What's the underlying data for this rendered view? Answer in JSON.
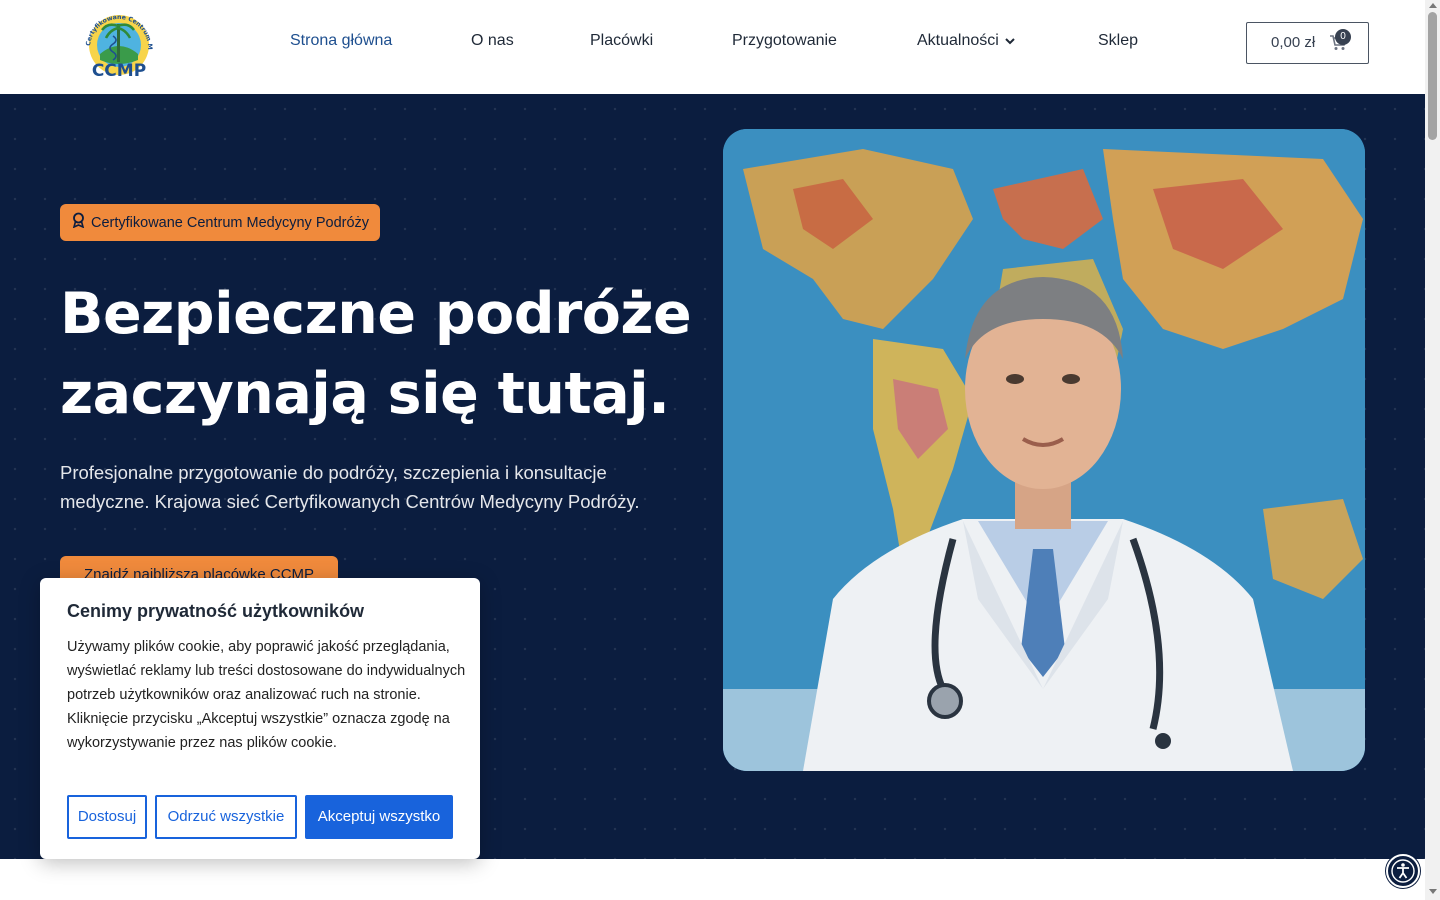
{
  "header": {
    "logo_text": "CCMP",
    "logo_arc_text": "Certyfikowane Centrum Medycyny Podróży",
    "nav": {
      "home": "Strona główna",
      "about": "O nas",
      "locations": "Placówki",
      "preparation": "Przygotowanie",
      "news": "Aktualności",
      "shop": "Sklep"
    },
    "cart": {
      "total": "0,00 zł",
      "count": "0"
    }
  },
  "hero": {
    "badge": "Certyfikowane Centrum Medycyny Podróży",
    "title_line1": "Bezpieczne podróże",
    "title_line2": "zaczynają się tutaj.",
    "subtitle": "Profesjonalne przygotowanie do podróży, szczepienia i konsultacje medyczne. Krajowa sieć Certyfikowanych Centrów Medycyny Podróży.",
    "cta": "Znajdź najbliższą placówkę CCMP"
  },
  "cookie": {
    "title": "Cenimy prywatność użytkowników",
    "text": "Używamy plików cookie, aby poprawić jakość przeglądania, wyświetlać reklamy lub treści dostosowane do indywidualnych potrzeb użytkowników oraz analizować ruch na stronie. Kliknięcie przycisku „Akceptuj wszystkie” oznacza zgodę na wykorzystywanie przez nas plików cookie.",
    "customize": "Dostosuj",
    "reject": "Odrzuć wszystkie",
    "accept": "Akceptuj wszystko"
  },
  "colors": {
    "navy": "#0b1d3f",
    "accent_orange": "#f08a3c",
    "cookie_blue": "#1863dc",
    "nav_active": "#1e4f8f"
  },
  "icons": {
    "badge": "award-icon",
    "cart": "shopping-cart-icon",
    "nav_dropdown": "chevron-down-icon",
    "accessibility": "accessibility-icon"
  }
}
